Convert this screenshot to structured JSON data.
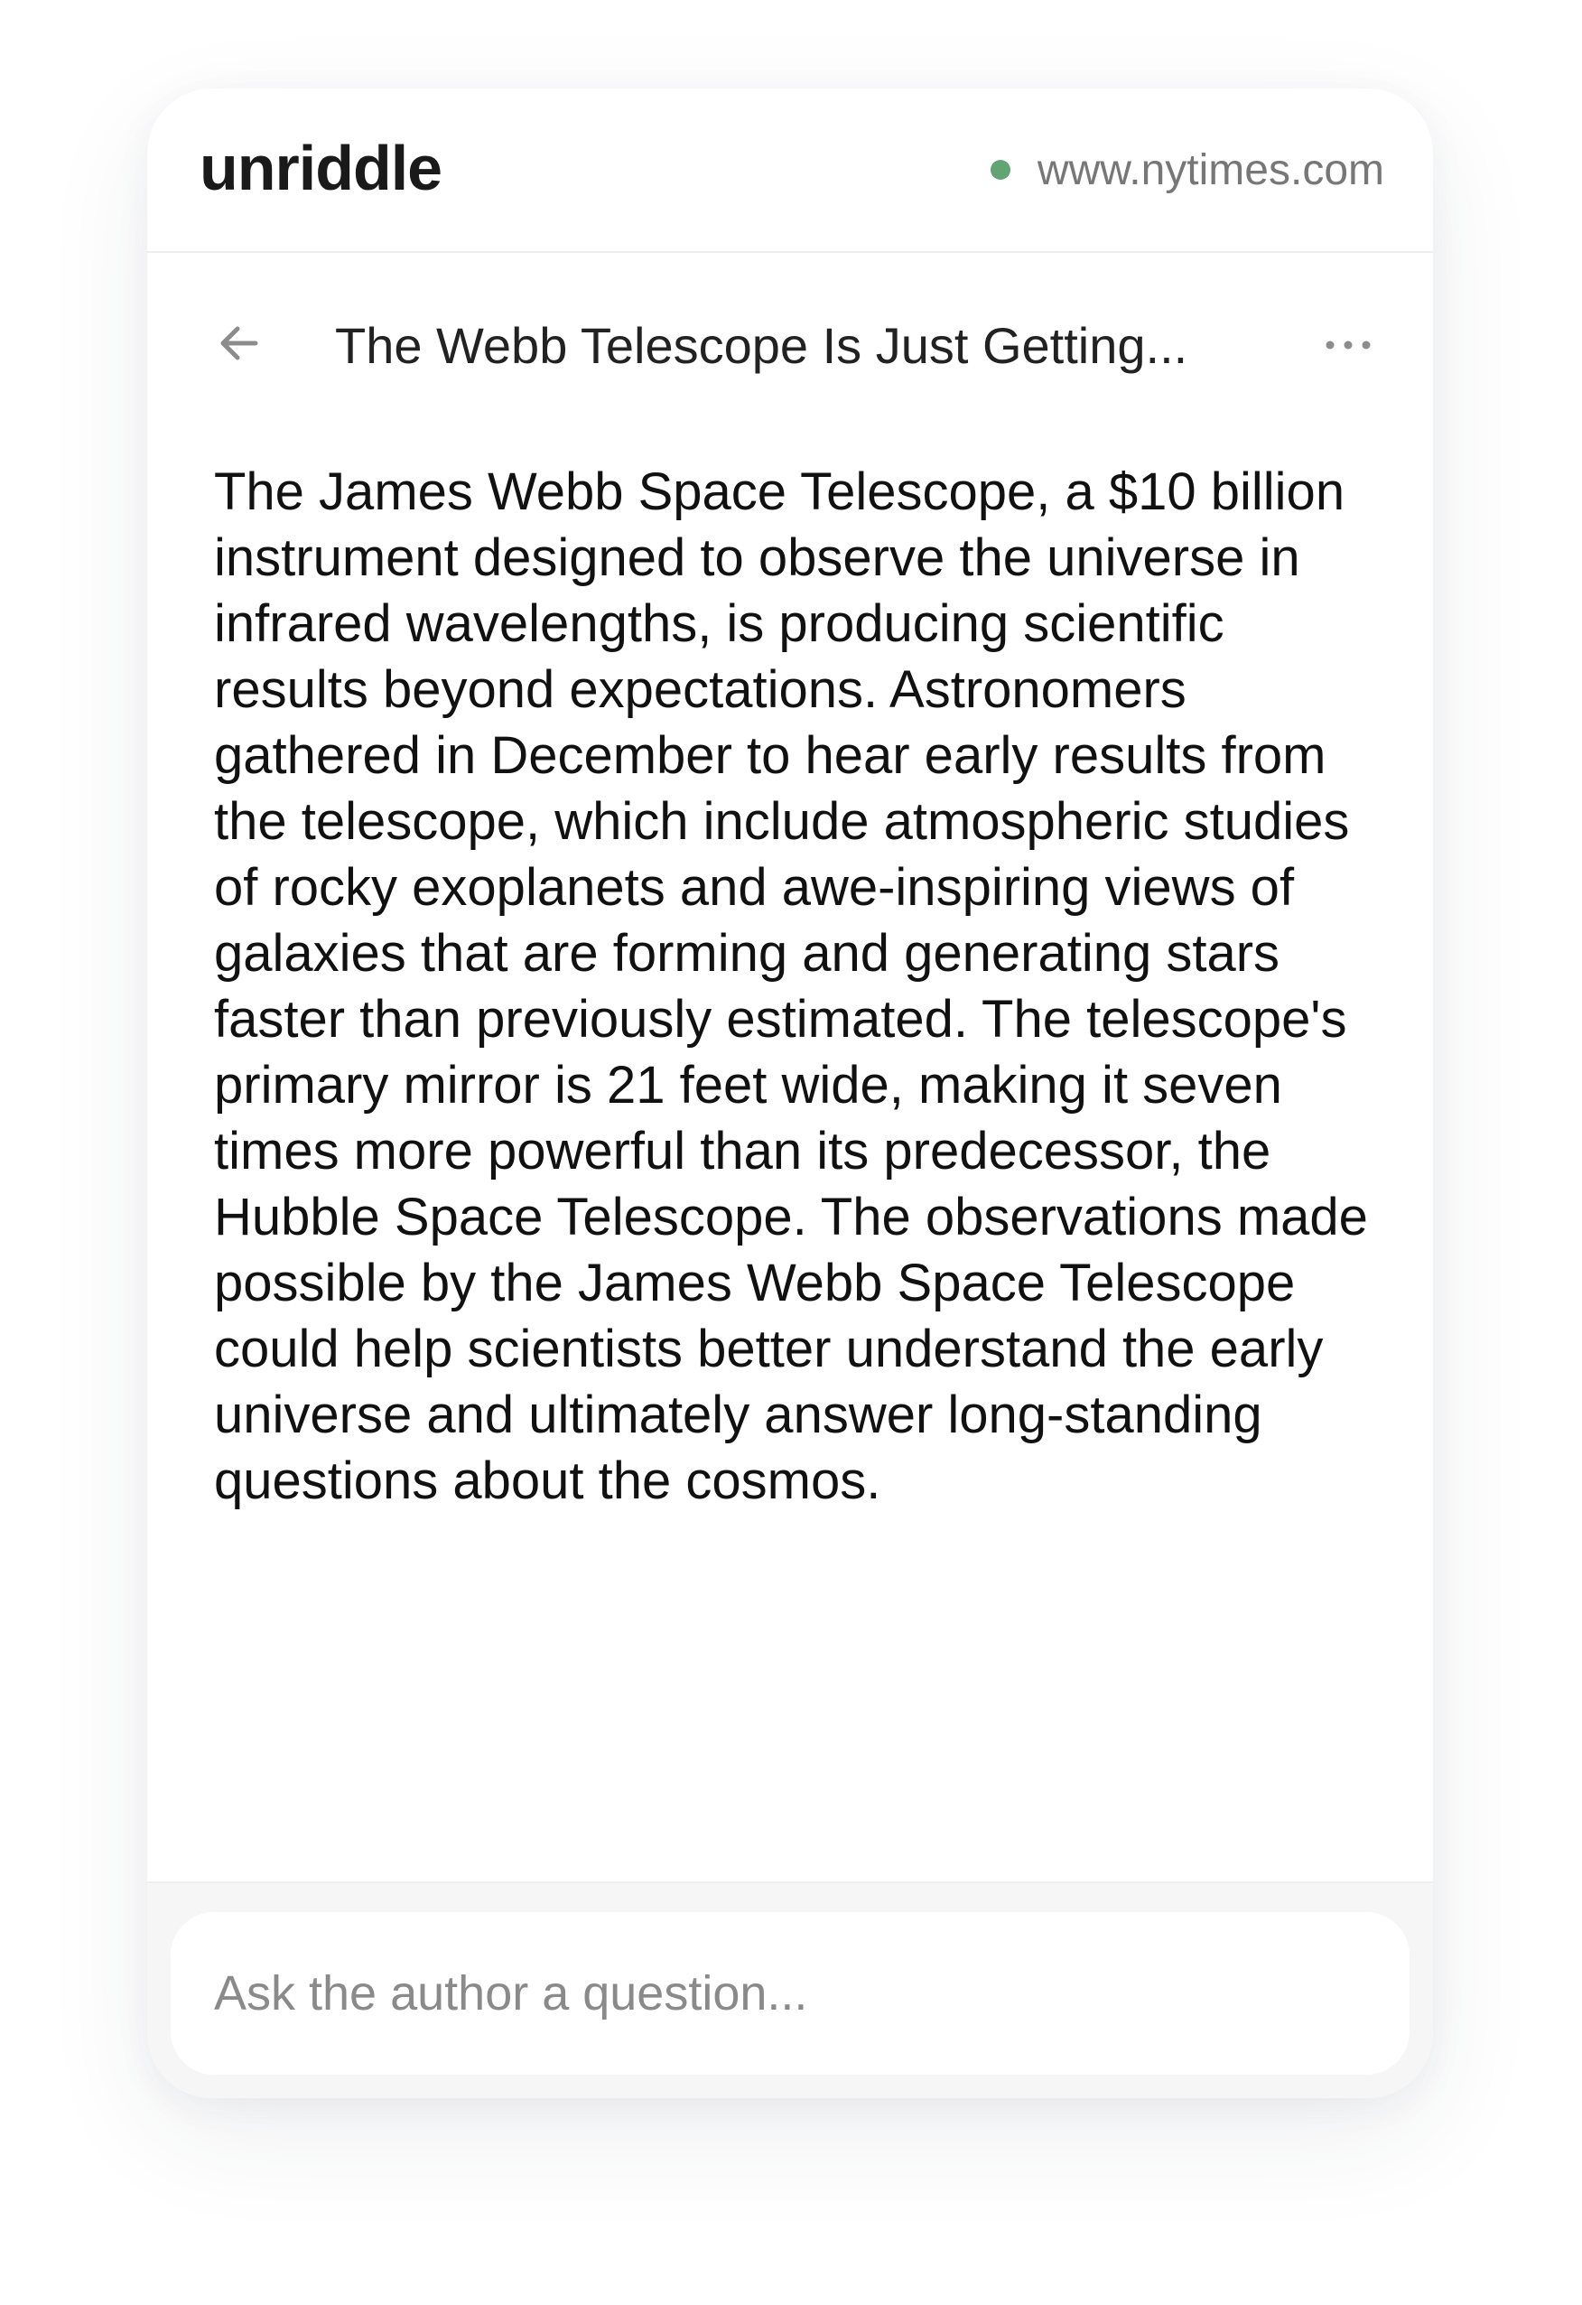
{
  "header": {
    "brand": "unriddle",
    "site": "www.nytimes.com",
    "status_color": "#62a474"
  },
  "article": {
    "title": "The Webb Telescope Is Just Getting...",
    "body": "The James Webb Space Telescope, a $10 billion instrument designed to observe the universe in infrared wavelengths, is producing scientific results beyond expectations. Astronomers gathered in December to hear early results from the telescope, which include atmospheric studies of rocky exoplanets and awe-inspiring views of galaxies that are forming and generating stars faster than previously estimated. The telescope's primary mirror is 21 feet wide, making it seven times more powerful than its predecessor, the Hubble Space Telescope. The observations made possible by the James Webb Space Telescope could help scientists better understand the early universe and ultimately answer long-standing questions about the cosmos."
  },
  "icons": {
    "back": "arrow-left-icon",
    "more": "more-horizontal-icon"
  },
  "footer": {
    "ask_placeholder": "Ask the author a question...",
    "ask_value": ""
  }
}
